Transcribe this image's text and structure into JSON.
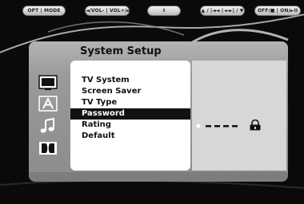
{
  "hints": {
    "opt_mode": "OPT | MODE",
    "volume": "◄/VOL- | VOL+/►",
    "updown": "⇕",
    "skip": "▲ / |◄◄ | ►►| / ▼",
    "power": "OFF/■ | ON/►II"
  },
  "panel": {
    "title": "System  Setup"
  },
  "side_icons": [
    "tv-icon",
    "audio-icon",
    "music-note-icon",
    "dolby-icon"
  ],
  "menu": {
    "items": [
      {
        "label": "TV  System",
        "active": false
      },
      {
        "label": "Screen  Saver",
        "active": false
      },
      {
        "label": "TV Type",
        "active": false
      },
      {
        "label": "Password",
        "active": true
      },
      {
        "label": "Rating",
        "active": false
      },
      {
        "label": "Default",
        "active": false
      }
    ]
  },
  "detail": {
    "password_icon": "lock-icon"
  },
  "colors": {
    "highlight": "#111111",
    "panel": "#9a9a9a",
    "menu_bg": "#ffffff"
  }
}
